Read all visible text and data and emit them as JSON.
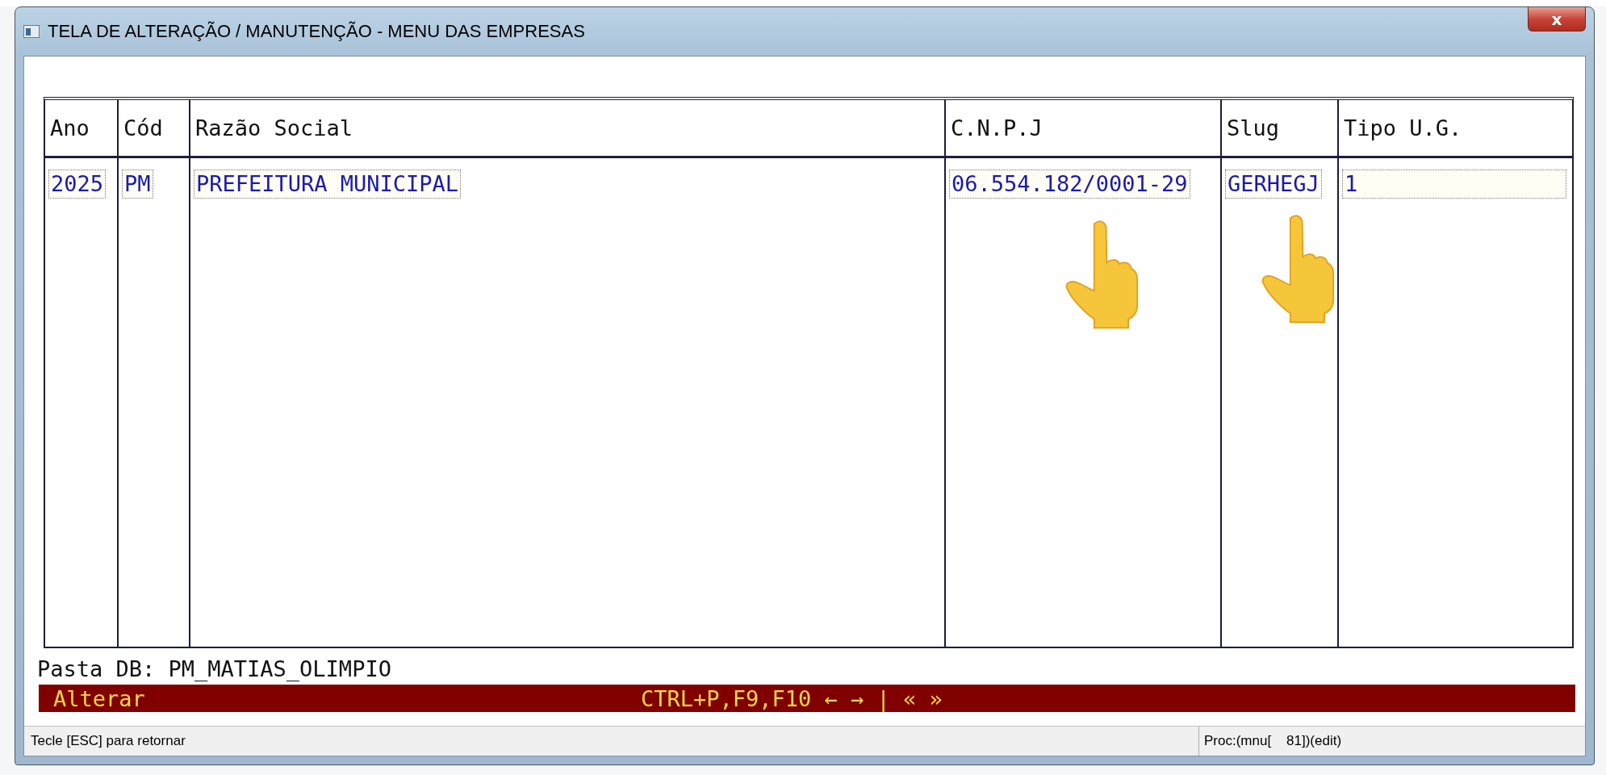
{
  "window": {
    "title": "TELA DE ALTERAÇÃO / MANUTENÇÃO - MENU DAS EMPRESAS",
    "close": "x"
  },
  "table": {
    "columns": [
      "Ano",
      "Cód",
      "Razão Social",
      "C.N.P.J",
      "Slug",
      "Tipo U.G."
    ],
    "rows": [
      {
        "selected": true,
        "cells": [
          "2025",
          "PM",
          "PREFEITURA MUNICIPAL",
          "06.554.182/0001-29",
          "GERHEGJ",
          "1"
        ]
      }
    ]
  },
  "db_folder": "Pasta DB: PM_MATIAS_OLIMPIO",
  "command_bar": {
    "mode": "Alterar",
    "keys": "CTRL+P,F9,F10 ← → | « »"
  },
  "status_bar": [
    "Tecle [ESC] para retornar",
    "Proc:(mnu[    81])(edit)"
  ]
}
